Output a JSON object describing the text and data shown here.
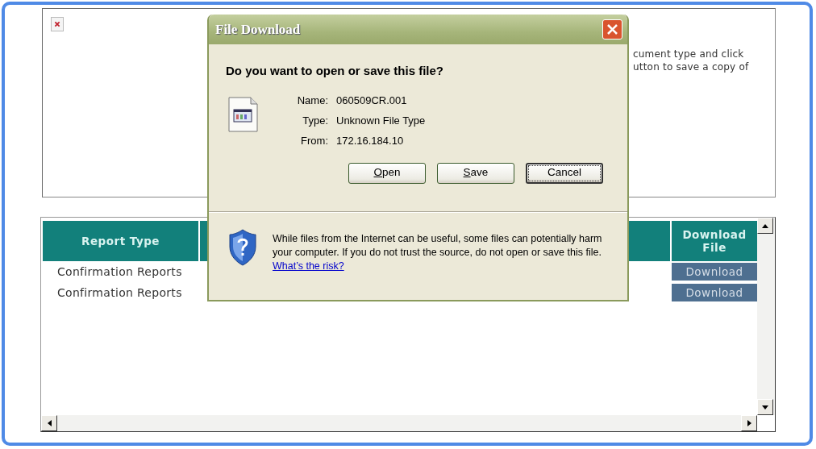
{
  "page": {
    "intro_lines": [
      "cument type and click",
      "utton to save a copy of"
    ]
  },
  "report_table": {
    "columns": [
      "Report Type",
      "Download File"
    ],
    "rows": [
      {
        "report_type": "Confirmation Reports",
        "action": "Download"
      },
      {
        "report_type": "Confirmation Reports",
        "action": "Download"
      }
    ]
  },
  "dialog": {
    "title": "File Download",
    "question": "Do you want to open or save this file?",
    "fields": [
      {
        "label": "Name:",
        "value": "060509CR.001"
      },
      {
        "label": "Type:",
        "value": "Unknown File Type"
      },
      {
        "label": "From:",
        "value": "172.16.184.10"
      }
    ],
    "buttons": [
      {
        "label": "Open",
        "mnemonic": true,
        "default": false
      },
      {
        "label": "Save",
        "mnemonic": true,
        "default": false
      },
      {
        "label": "Cancel",
        "mnemonic": false,
        "default": true
      }
    ],
    "warning": {
      "text": "While files from the Internet can be useful, some files can potentially harm your computer. If you do not trust the source, do not open or save this file.",
      "link": "What’s the risk?"
    }
  }
}
